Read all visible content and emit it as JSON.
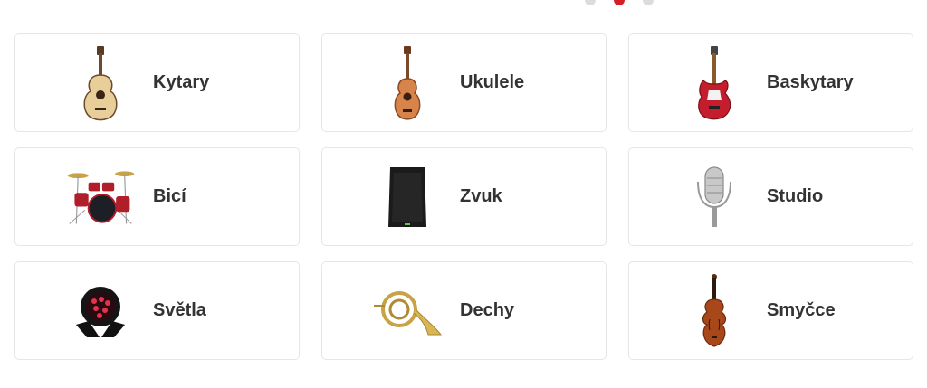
{
  "carousel": {
    "page_count": 3,
    "active_index": 1
  },
  "categories": [
    {
      "label": "Kytary",
      "icon": "acoustic-guitar-icon"
    },
    {
      "label": "Ukulele",
      "icon": "ukulele-icon"
    },
    {
      "label": "Baskytary",
      "icon": "bass-guitar-icon"
    },
    {
      "label": "Bicí",
      "icon": "drum-kit-icon"
    },
    {
      "label": "Zvuk",
      "icon": "speaker-icon"
    },
    {
      "label": "Studio",
      "icon": "studio-microphone-icon"
    },
    {
      "label": "Světla",
      "icon": "stage-light-icon"
    },
    {
      "label": "Dechy",
      "icon": "french-horn-icon"
    },
    {
      "label": "Smyčce",
      "icon": "violin-icon"
    }
  ],
  "colors": {
    "accent": "#d41f26",
    "dot_inactive": "#dcdcdc",
    "card_border": "#e6e6e6",
    "text": "#333333"
  }
}
